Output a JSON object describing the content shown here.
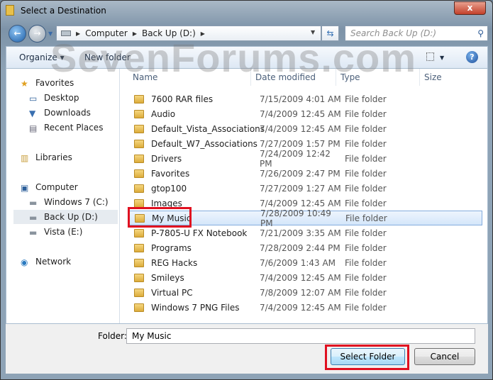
{
  "window": {
    "title": "Select a Destination",
    "close": "x"
  },
  "address": {
    "crumbs": [
      "Computer",
      "Back Up (D:)"
    ],
    "search_placeholder": "Search Back Up (D:)"
  },
  "toolbar": {
    "organize": "Organize ▾",
    "new_folder": "New folder",
    "help": "?"
  },
  "sidebar": {
    "items": [
      {
        "label": "Favorites",
        "icon": "star-icon",
        "level": 0
      },
      {
        "label": "Desktop",
        "icon": "desktop-icon",
        "level": 1
      },
      {
        "label": "Downloads",
        "icon": "downloads-icon",
        "level": 1
      },
      {
        "label": "Recent Places",
        "icon": "recent-places-icon",
        "level": 1
      },
      {
        "label": "Libraries",
        "icon": "libraries-icon",
        "level": 0
      },
      {
        "label": "Computer",
        "icon": "computer-icon",
        "level": 0
      },
      {
        "label": "Windows 7 (C:)",
        "icon": "drive-icon",
        "level": 1
      },
      {
        "label": "Back Up (D:)",
        "icon": "drive-icon",
        "level": 1,
        "selected": true
      },
      {
        "label": "Vista (E:)",
        "icon": "drive-icon",
        "level": 1
      },
      {
        "label": "Network",
        "icon": "network-icon",
        "level": 0
      }
    ]
  },
  "columns": [
    "Name",
    "Date modified",
    "Type",
    "Size"
  ],
  "files": [
    {
      "name": "7600 RAR files",
      "date": "7/15/2009 4:01 AM",
      "type": "File folder"
    },
    {
      "name": "Audio",
      "date": "7/4/2009 12:45 AM",
      "type": "File folder"
    },
    {
      "name": "Default_Vista_Associations",
      "date": "7/4/2009 12:45 AM",
      "type": "File folder"
    },
    {
      "name": "Default_W7_Associations",
      "date": "7/27/2009 1:57 PM",
      "type": "File folder"
    },
    {
      "name": "Drivers",
      "date": "7/24/2009 12:42 PM",
      "type": "File folder"
    },
    {
      "name": "Favorites",
      "date": "7/26/2009 2:47 PM",
      "type": "File folder"
    },
    {
      "name": "gtop100",
      "date": "7/27/2009 1:27 AM",
      "type": "File folder"
    },
    {
      "name": "Images",
      "date": "7/4/2009 12:45 AM",
      "type": "File folder"
    },
    {
      "name": "My Music",
      "date": "7/28/2009 10:49 PM",
      "type": "File folder",
      "selected": true
    },
    {
      "name": "P-7805-U FX Notebook",
      "date": "7/21/2009 3:35 AM",
      "type": "File folder"
    },
    {
      "name": "Programs",
      "date": "7/28/2009 2:44 PM",
      "type": "File folder"
    },
    {
      "name": "REG Hacks",
      "date": "7/6/2009 1:43 AM",
      "type": "File folder"
    },
    {
      "name": "Smileys",
      "date": "7/4/2009 12:45 AM",
      "type": "File folder"
    },
    {
      "name": "Virtual PC",
      "date": "7/8/2009 12:07 AM",
      "type": "File folder"
    },
    {
      "name": "Windows 7 PNG Files",
      "date": "7/4/2009 12:45 AM",
      "type": "File folder"
    }
  ],
  "footer": {
    "folder_label": "Folder:",
    "folder_value": "My Music",
    "select_button": "Select Folder",
    "cancel_button": "Cancel"
  },
  "watermark": "SevenForums.com",
  "colors": {
    "highlight": "#e01020",
    "selection": "#d4e6fa"
  }
}
